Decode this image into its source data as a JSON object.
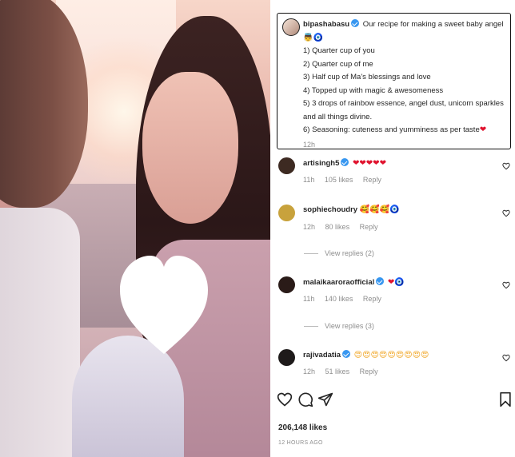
{
  "post": {
    "username": "bipashabasu",
    "caption_lines": [
      "Our recipe for making a sweet baby angel",
      "1) Quarter cup of you",
      "2) Quarter cup of me",
      "3) Half cup of Ma's blessings and love",
      "4) Topped up with magic & awesomeness",
      "5) 3 drops of rainbow essence, angel dust, unicorn sparkles and all things divine.",
      "6) Seasoning: cuteness and yumminess as per taste"
    ],
    "caption_emoji_1": "👼",
    "caption_emoji_2": "🧿",
    "caption_emoji_3": "❤",
    "time": "12h",
    "likes": "206,148 likes",
    "posted": "12 HOURS AGO"
  },
  "comments": [
    {
      "username": "artisingh5",
      "text": "❤❤❤❤❤",
      "time": "11h",
      "likes": "105 likes",
      "reply": "Reply",
      "avatar_color": "#3d2a22"
    },
    {
      "username": "sophiechoudry",
      "text": "🥰🥰🥰🧿",
      "time": "12h",
      "likes": "80 likes",
      "reply": "Reply",
      "avatar_color": "#c8a23c",
      "view_replies": "View replies (2)"
    },
    {
      "username": "malaikaaroraofficial",
      "text": "❤🧿",
      "time": "11h",
      "likes": "140 likes",
      "reply": "Reply",
      "avatar_color": "#2a1b18",
      "view_replies": "View replies (3)"
    },
    {
      "username": "rajivadatia",
      "text": "😍😍😍😍😍😍😍😍😍",
      "time": "12h",
      "likes": "51 likes",
      "reply": "Reply",
      "avatar_color": "#1e1a1a"
    }
  ],
  "icons": {
    "like": "heart-icon",
    "comment": "comment-icon",
    "share": "share-icon",
    "save": "bookmark-icon"
  },
  "colors": {
    "verified": "#3897f0",
    "heart_red": "#e0132e",
    "muted_text": "#8e8e8e"
  }
}
